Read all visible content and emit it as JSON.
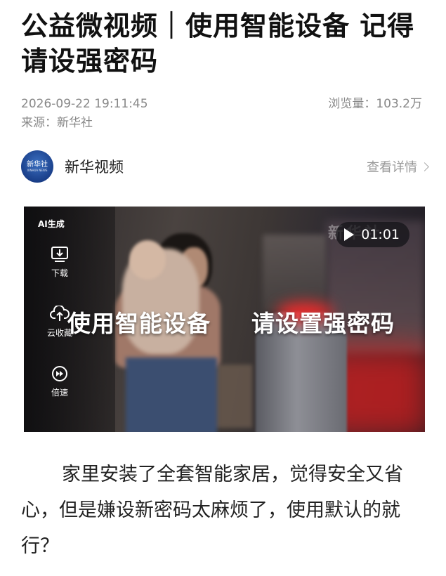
{
  "article": {
    "title": "公益微视频｜使用智能设备 记得请设强密码",
    "datetime": "2026-09-22 19:11:45",
    "views_label": "浏览量：",
    "views_value": "103.2万",
    "source": "来源：新华社",
    "author": {
      "name": "新华视频",
      "avatar_text": "新华社",
      "avatar_subtext": "XINHUA NEWS",
      "detail_link": "查看详情"
    },
    "body": "家里安装了全套智能家居，觉得安全又省心，但是嫌设新密码太麻烦了，使用默认的就行？"
  },
  "video": {
    "ai_badge": "AI生成",
    "duration": "01:01",
    "overlay_left": "使用智能设备",
    "overlay_right": "请设置强密码",
    "watermark": "新华社",
    "controls": [
      {
        "label": "下载",
        "icon": "download-icon"
      },
      {
        "label": "云收藏",
        "icon": "cloud-upload-icon"
      },
      {
        "label": "倍速",
        "icon": "speed-icon"
      }
    ]
  }
}
